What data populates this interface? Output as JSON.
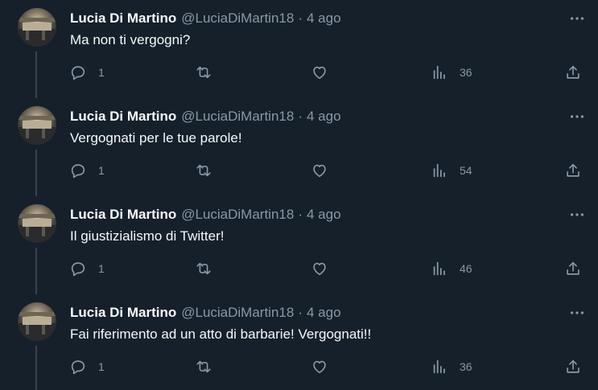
{
  "tweets": [
    {
      "author_name": "Lucia Di Martino",
      "handle": "@LuciaDiMartin18",
      "separator": "·",
      "time": "4 ago",
      "text": "Ma non ti vergogni?",
      "replies": "1",
      "views": "36"
    },
    {
      "author_name": "Lucia Di Martino",
      "handle": "@LuciaDiMartin18",
      "separator": "·",
      "time": "4 ago",
      "text": "Vergognati per le tue parole!",
      "replies": "1",
      "views": "54"
    },
    {
      "author_name": "Lucia Di Martino",
      "handle": "@LuciaDiMartin18",
      "separator": "·",
      "time": "4 ago",
      "text": "Il giustizialismo di Twitter!",
      "replies": "1",
      "views": "46"
    },
    {
      "author_name": "Lucia Di Martino",
      "handle": "@LuciaDiMartin18",
      "separator": "·",
      "time": "4 ago",
      "text": "Fai riferimento ad un atto di barbarie! Vergognati!!",
      "replies": "1",
      "views": "36"
    }
  ],
  "icons": {
    "more": "more-dots-icon",
    "reply": "reply-bubble-icon",
    "retweet": "retweet-icon",
    "like": "heart-icon",
    "views": "views-bar-chart-icon",
    "share": "share-upload-icon"
  },
  "colors": {
    "background": "#15202b",
    "primary_text": "#f7f9f9",
    "secondary_text": "#8b98a5",
    "thread_line": "#38444d"
  }
}
